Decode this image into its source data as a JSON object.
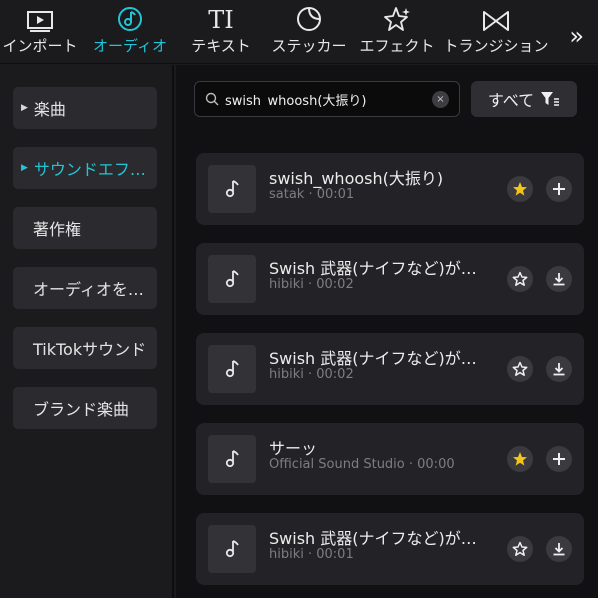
{
  "toolbar": {
    "tabs": [
      {
        "label": "インポート",
        "icon": "media-icon",
        "active": false
      },
      {
        "label": "オーディオ",
        "icon": "audio-note-icon",
        "active": true
      },
      {
        "label": "テキスト",
        "icon": "text-icon",
        "glyph": "TI",
        "active": false
      },
      {
        "label": "ステッカー",
        "icon": "sticker-icon",
        "active": false
      },
      {
        "label": "エフェクト",
        "icon": "effects-sparkle-icon",
        "active": false
      },
      {
        "label": "トランジション",
        "icon": "transition-icon",
        "active": false
      }
    ],
    "more_glyph": "»"
  },
  "sidebar": {
    "items": [
      {
        "label": "楽曲",
        "expandable": true,
        "active": false
      },
      {
        "label": "サウンドエフ…",
        "expandable": true,
        "active": true
      },
      {
        "label": "著作権",
        "expandable": false,
        "active": false
      },
      {
        "label": "オーディオを…",
        "expandable": false,
        "active": false
      },
      {
        "label": "TikTokサウンド",
        "expandable": false,
        "active": false
      },
      {
        "label": "ブランド楽曲",
        "expandable": false,
        "active": false
      }
    ]
  },
  "search": {
    "value": "swish_whoosh(大振り)",
    "clear_glyph": "×"
  },
  "filter": {
    "label": "すべて"
  },
  "results": [
    {
      "title": "swish_whoosh(大振り)",
      "meta": "satak · 00:01",
      "favorited": true,
      "action": "add"
    },
    {
      "title": "Swish 武器(ナイフなど)が…",
      "meta": "hibiki · 00:02",
      "favorited": false,
      "action": "download"
    },
    {
      "title": "Swish 武器(ナイフなど)が…",
      "meta": "hibiki · 00:02",
      "favorited": false,
      "action": "download"
    },
    {
      "title": "サーッ",
      "meta": "Official Sound Studio · 00:00",
      "favorited": true,
      "action": "add"
    },
    {
      "title": "Swish 武器(ナイフなど)が…",
      "meta": "hibiki · 00:01",
      "favorited": false,
      "action": "download"
    }
  ],
  "colors": {
    "accent": "#21c5d6",
    "favorite_star": "#f5c518",
    "background": "#1b1b1e",
    "panel": "#111113",
    "card": "#232327"
  }
}
